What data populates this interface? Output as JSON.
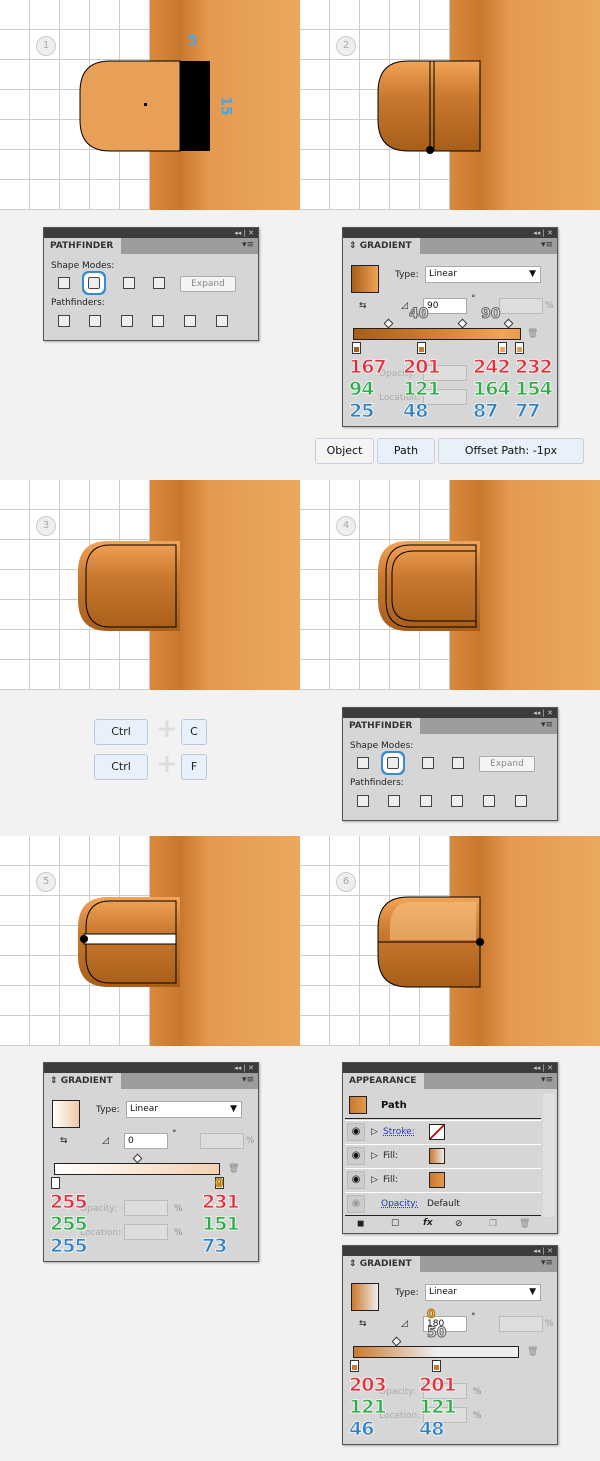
{
  "steps": [
    "1",
    "2",
    "3",
    "4",
    "5",
    "6"
  ],
  "step1": {
    "width_label": "5",
    "height_label": "15"
  },
  "pathfinder": {
    "title": "PATHFINDER",
    "shape_modes": "Shape Modes:",
    "pathfinders": "Pathfinders:",
    "expand": "Expand"
  },
  "gradient1": {
    "title": "GRADIENT",
    "type_label": "Type:",
    "type_value": "Linear",
    "angle": "90",
    "degree": "°",
    "pct": "%",
    "opacity_label": "Opacity:",
    "location_label": "Location:",
    "midpoint_callouts": [
      "40",
      "90"
    ],
    "stops": [
      {
        "r": "167",
        "g": "94",
        "b": "25"
      },
      {
        "r": "201",
        "g": "121",
        "b": "48"
      },
      {
        "r": "242",
        "g": "164",
        "b": "87"
      },
      {
        "r": "232",
        "g": "154",
        "b": "77"
      }
    ]
  },
  "menu_path": [
    "Object",
    "Path",
    "Offset Path: -1px"
  ],
  "shortcuts": [
    {
      "mod": "Ctrl",
      "key": "C"
    },
    {
      "mod": "Ctrl",
      "key": "F"
    }
  ],
  "gradient2": {
    "title": "GRADIENT",
    "type_label": "Type:",
    "type_value": "Linear",
    "angle": "0",
    "degree": "°",
    "pct": "%",
    "opacity_label": "Opacity:",
    "location_label": "Location:",
    "stop_callout": "0",
    "stops": [
      {
        "r": "255",
        "g": "255",
        "b": "255"
      },
      {
        "r": "231",
        "g": "151",
        "b": "73"
      }
    ]
  },
  "appearance": {
    "title": "APPEARANCE",
    "object": "Path",
    "rows": [
      {
        "label": "Stroke:"
      },
      {
        "label": "Fill:"
      },
      {
        "label": "Fill:"
      }
    ],
    "opacity_label": "Opacity:",
    "opacity_value": "Default"
  },
  "gradient3": {
    "title": "GRADIENT",
    "type_label": "Type:",
    "type_value": "Linear",
    "angle": "180",
    "degree": "°",
    "pct": "%",
    "opacity_label": "Opacity:",
    "location_label": "Location:",
    "stop_callout": "0",
    "midpoint_callout": "50",
    "stops": [
      {
        "r": "203",
        "g": "121",
        "b": "46"
      },
      {
        "r": "201",
        "g": "121",
        "b": "48"
      }
    ]
  },
  "colors": {
    "orange": "#e49a50",
    "red": "#e0303a",
    "green": "#2eaa4a",
    "blue": "#2f7fc0"
  }
}
